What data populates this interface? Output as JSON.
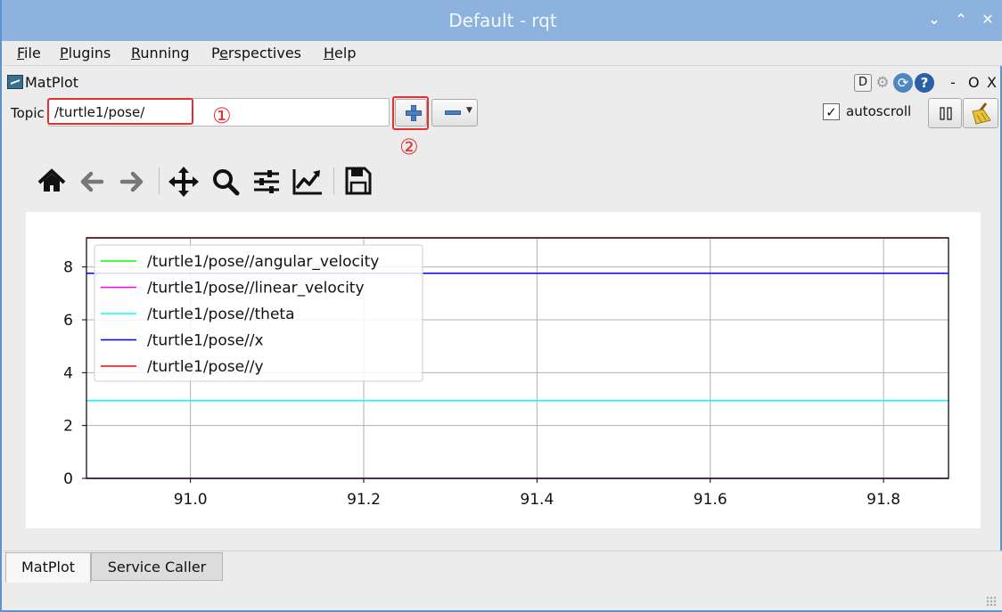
{
  "window": {
    "title": "Default - rqt",
    "controls": [
      "⌄",
      "⌃",
      "✕"
    ]
  },
  "menubar": {
    "items": [
      {
        "mnemonic": "F",
        "rest": "ile"
      },
      {
        "mnemonic": "P",
        "rest": "lugins"
      },
      {
        "mnemonic": "R",
        "rest": "unning"
      },
      {
        "pre": "P",
        "mnemonic": "e",
        "rest": "rspectives"
      },
      {
        "mnemonic": "H",
        "rest": "elp"
      }
    ]
  },
  "plugin": {
    "title": "MatPlot",
    "header_buttons": {
      "d": "D",
      "help": "?",
      "minimize": "-",
      "float": "O",
      "close": "X"
    }
  },
  "topic": {
    "label": "Topic",
    "value": "/turtle1/pose/"
  },
  "annotations": {
    "one": "①",
    "two": "②"
  },
  "autoscroll": {
    "checked": true,
    "check_mark": "✓",
    "label": "autoscroll"
  },
  "toolbar_icons": [
    "home-icon",
    "back-arrow-icon",
    "forward-arrow-icon",
    "pan-icon",
    "zoom-icon",
    "subplot-config-icon",
    "edit-axis-icon",
    "save-icon"
  ],
  "chart_data": {
    "type": "line",
    "title": "",
    "xlabel": "",
    "ylabel": "",
    "xlim": [
      90.88,
      91.875
    ],
    "ylim": [
      0,
      9.1
    ],
    "xticks": [
      91.0,
      91.2,
      91.4,
      91.6,
      91.8
    ],
    "xtick_labels": [
      "91.0",
      "91.2",
      "91.4",
      "91.6",
      "91.8"
    ],
    "yticks": [
      0,
      2,
      4,
      6,
      8
    ],
    "ytick_labels": [
      "0",
      "2",
      "4",
      "6",
      "8"
    ],
    "grid": true,
    "legend_position": "upper-left",
    "series": [
      {
        "name": "/turtle1/pose//angular_velocity",
        "color": "#00ff00",
        "x": [
          90.88,
          91.875
        ],
        "values": [
          0,
          0
        ]
      },
      {
        "name": "/turtle1/pose//linear_velocity",
        "color": "#ff00ff",
        "x": [
          90.88,
          91.875
        ],
        "values": [
          0,
          0
        ]
      },
      {
        "name": "/turtle1/pose//theta",
        "color": "#00ffff",
        "x": [
          90.88,
          91.875
        ],
        "values": [
          2.94,
          2.94
        ]
      },
      {
        "name": "/turtle1/pose//x",
        "color": "#0000ff",
        "x": [
          90.88,
          91.875
        ],
        "values": [
          7.76,
          7.76
        ]
      },
      {
        "name": "/turtle1/pose//y",
        "color": "#ff0000",
        "x": [
          90.88,
          91.875
        ],
        "values": [
          9.1,
          9.1
        ]
      }
    ]
  },
  "tabs": [
    {
      "label": "MatPlot",
      "active": true
    },
    {
      "label": "Service Caller",
      "active": false
    }
  ],
  "colors": {
    "titlebar": "#8cb2dd",
    "annotation_red": "#e53030",
    "plus_blue": "#4a7fc4"
  }
}
